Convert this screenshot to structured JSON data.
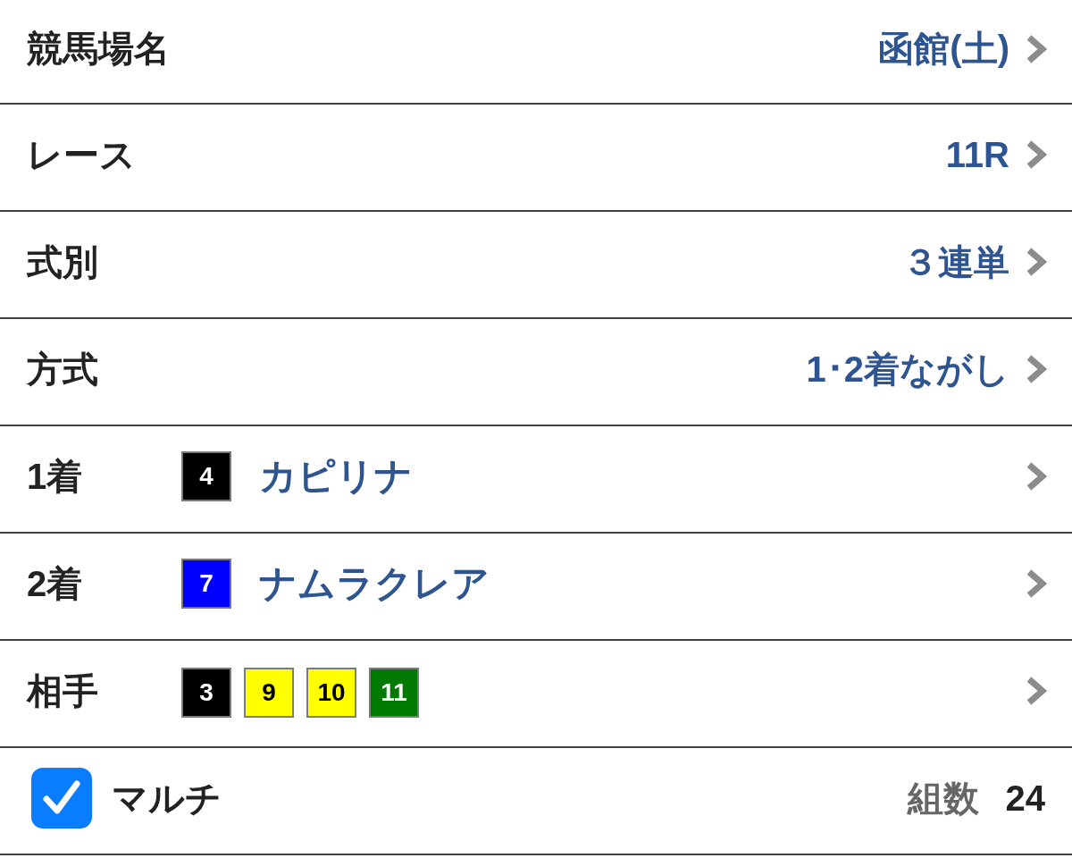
{
  "rows": [
    {
      "kind": "select",
      "label": "競馬場名",
      "value": "函館(土)"
    },
    {
      "kind": "select",
      "label": "レース",
      "value": "11R"
    },
    {
      "kind": "select",
      "label": "式別",
      "value": "３連単"
    },
    {
      "kind": "select",
      "label": "方式",
      "value": "1･2着ながし"
    },
    {
      "kind": "horse",
      "label": "1着",
      "horse": {
        "number": "4",
        "color": "#000000",
        "name": "カピリナ"
      }
    },
    {
      "kind": "horse",
      "label": "2着",
      "horse": {
        "number": "7",
        "color": "#0000ff",
        "name": "ナムラクレア"
      }
    },
    {
      "kind": "horses",
      "label": "相手",
      "horses": [
        {
          "number": "3",
          "color": "#000000"
        },
        {
          "number": "9",
          "color": "#ffff00"
        },
        {
          "number": "10",
          "color": "#ffff00"
        },
        {
          "number": "11",
          "color": "#007a00"
        }
      ]
    }
  ],
  "footer": {
    "multi": {
      "label": "マルチ",
      "checked": true
    },
    "count": {
      "label": "組数",
      "value": "24"
    }
  }
}
